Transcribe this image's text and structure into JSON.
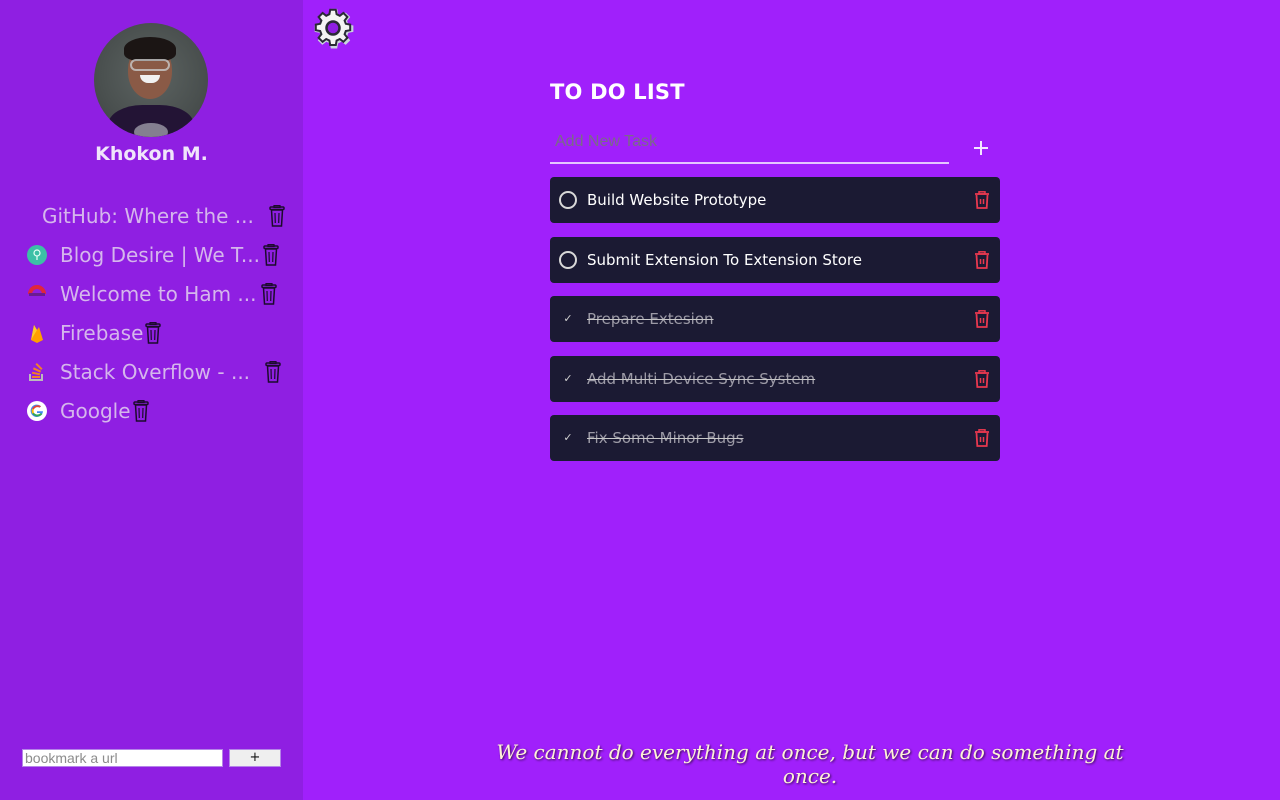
{
  "profile": {
    "name": "Khokon M."
  },
  "bookmarks": [
    {
      "label": "GitHub: Where the ...",
      "icon": "github-favicon"
    },
    {
      "label": "Blog Desire | We T...",
      "icon": "blog-desire-favicon"
    },
    {
      "label": "Welcome to Ham ...",
      "icon": "ham-favicon"
    },
    {
      "label": "Firebase",
      "icon": "firebase-favicon"
    },
    {
      "label": "Stack Overflow - ...",
      "icon": "stackoverflow-favicon"
    },
    {
      "label": "Google",
      "icon": "google-favicon"
    }
  ],
  "bookmark_form": {
    "placeholder": "bookmark a url",
    "value": "",
    "add_label": "+"
  },
  "todo": {
    "title": "TO DO LIST",
    "input_placeholder": "Add New Task",
    "input_value": "",
    "add_label": "+",
    "tasks": [
      {
        "text": "Build Website Prototype",
        "done": false
      },
      {
        "text": "Submit Extension To Extension Store",
        "done": false
      },
      {
        "text": "Prepare Extesion",
        "done": true
      },
      {
        "text": "Add Multi Device Sync System",
        "done": true
      },
      {
        "text": "Fix Some Minor Bugs",
        "done": true
      }
    ],
    "done_mark": "✓"
  },
  "quote": "We cannot do everything at once, but we can do something at once.",
  "colors": {
    "background": "#a020fb",
    "sidebar": "#8f1fe2",
    "task_card": "#1b1a33",
    "delete_red": "#e8384f"
  }
}
